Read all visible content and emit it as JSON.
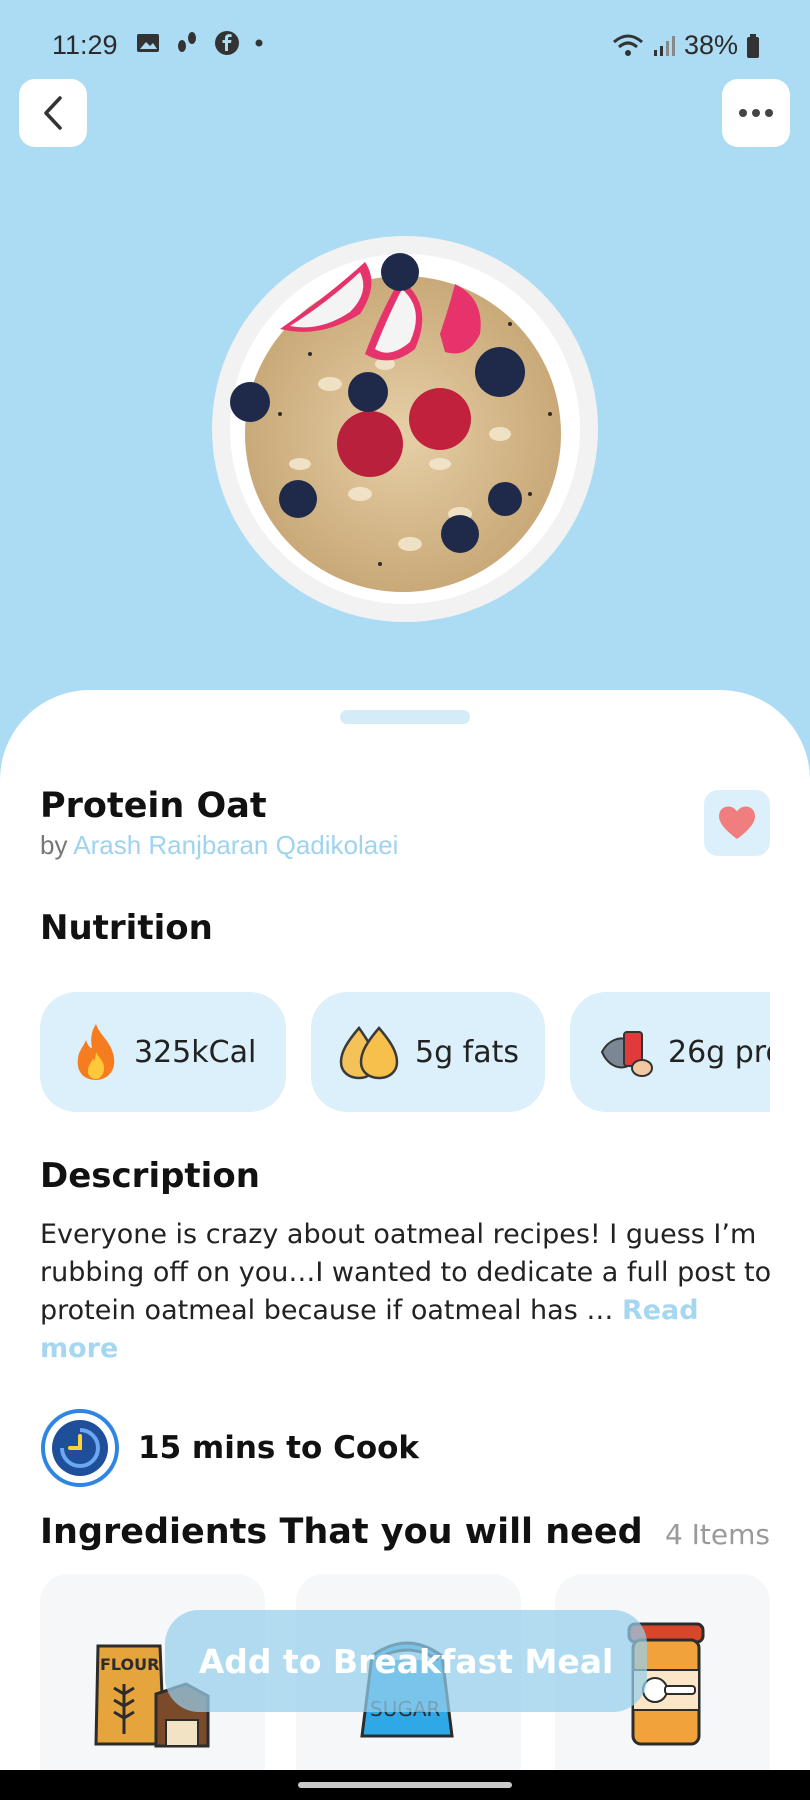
{
  "status_bar": {
    "time": "11:29",
    "battery": "38%"
  },
  "recipe": {
    "title": "Protein Oat",
    "author_prefix": "by",
    "author_name": "Arash Ranjbaran Qadikolaei"
  },
  "nutrition": {
    "title": "Nutrition",
    "chips": [
      {
        "icon": "fire-icon",
        "label": "325kCal"
      },
      {
        "icon": "fat-drops-icon",
        "label": "5g fats"
      },
      {
        "icon": "protein-icon",
        "label": "26g pro"
      }
    ]
  },
  "description": {
    "title": "Description",
    "text": "Everyone is crazy about oatmeal recipes! I guess I’m rubbing off on you…I wanted to dedicate a full post to protein oatmeal because if oatmeal has … ",
    "read_more": "Read more"
  },
  "cook_time": "15 mins to Cook",
  "ingredients": {
    "title": "Ingredients That you will need",
    "count": "4 Items",
    "items": [
      {
        "icon": "flour-icon",
        "label": "FLOUR"
      },
      {
        "icon": "sugar-icon",
        "label": "SUGAR"
      },
      {
        "icon": "protein-powder-can-icon"
      }
    ]
  },
  "action_button": "Add to Breakfast Meal",
  "colors": {
    "background": "#abdcf4",
    "accent": "#9fd3ee",
    "chip": "#dcf0fb",
    "heart": "#f07e7e"
  }
}
